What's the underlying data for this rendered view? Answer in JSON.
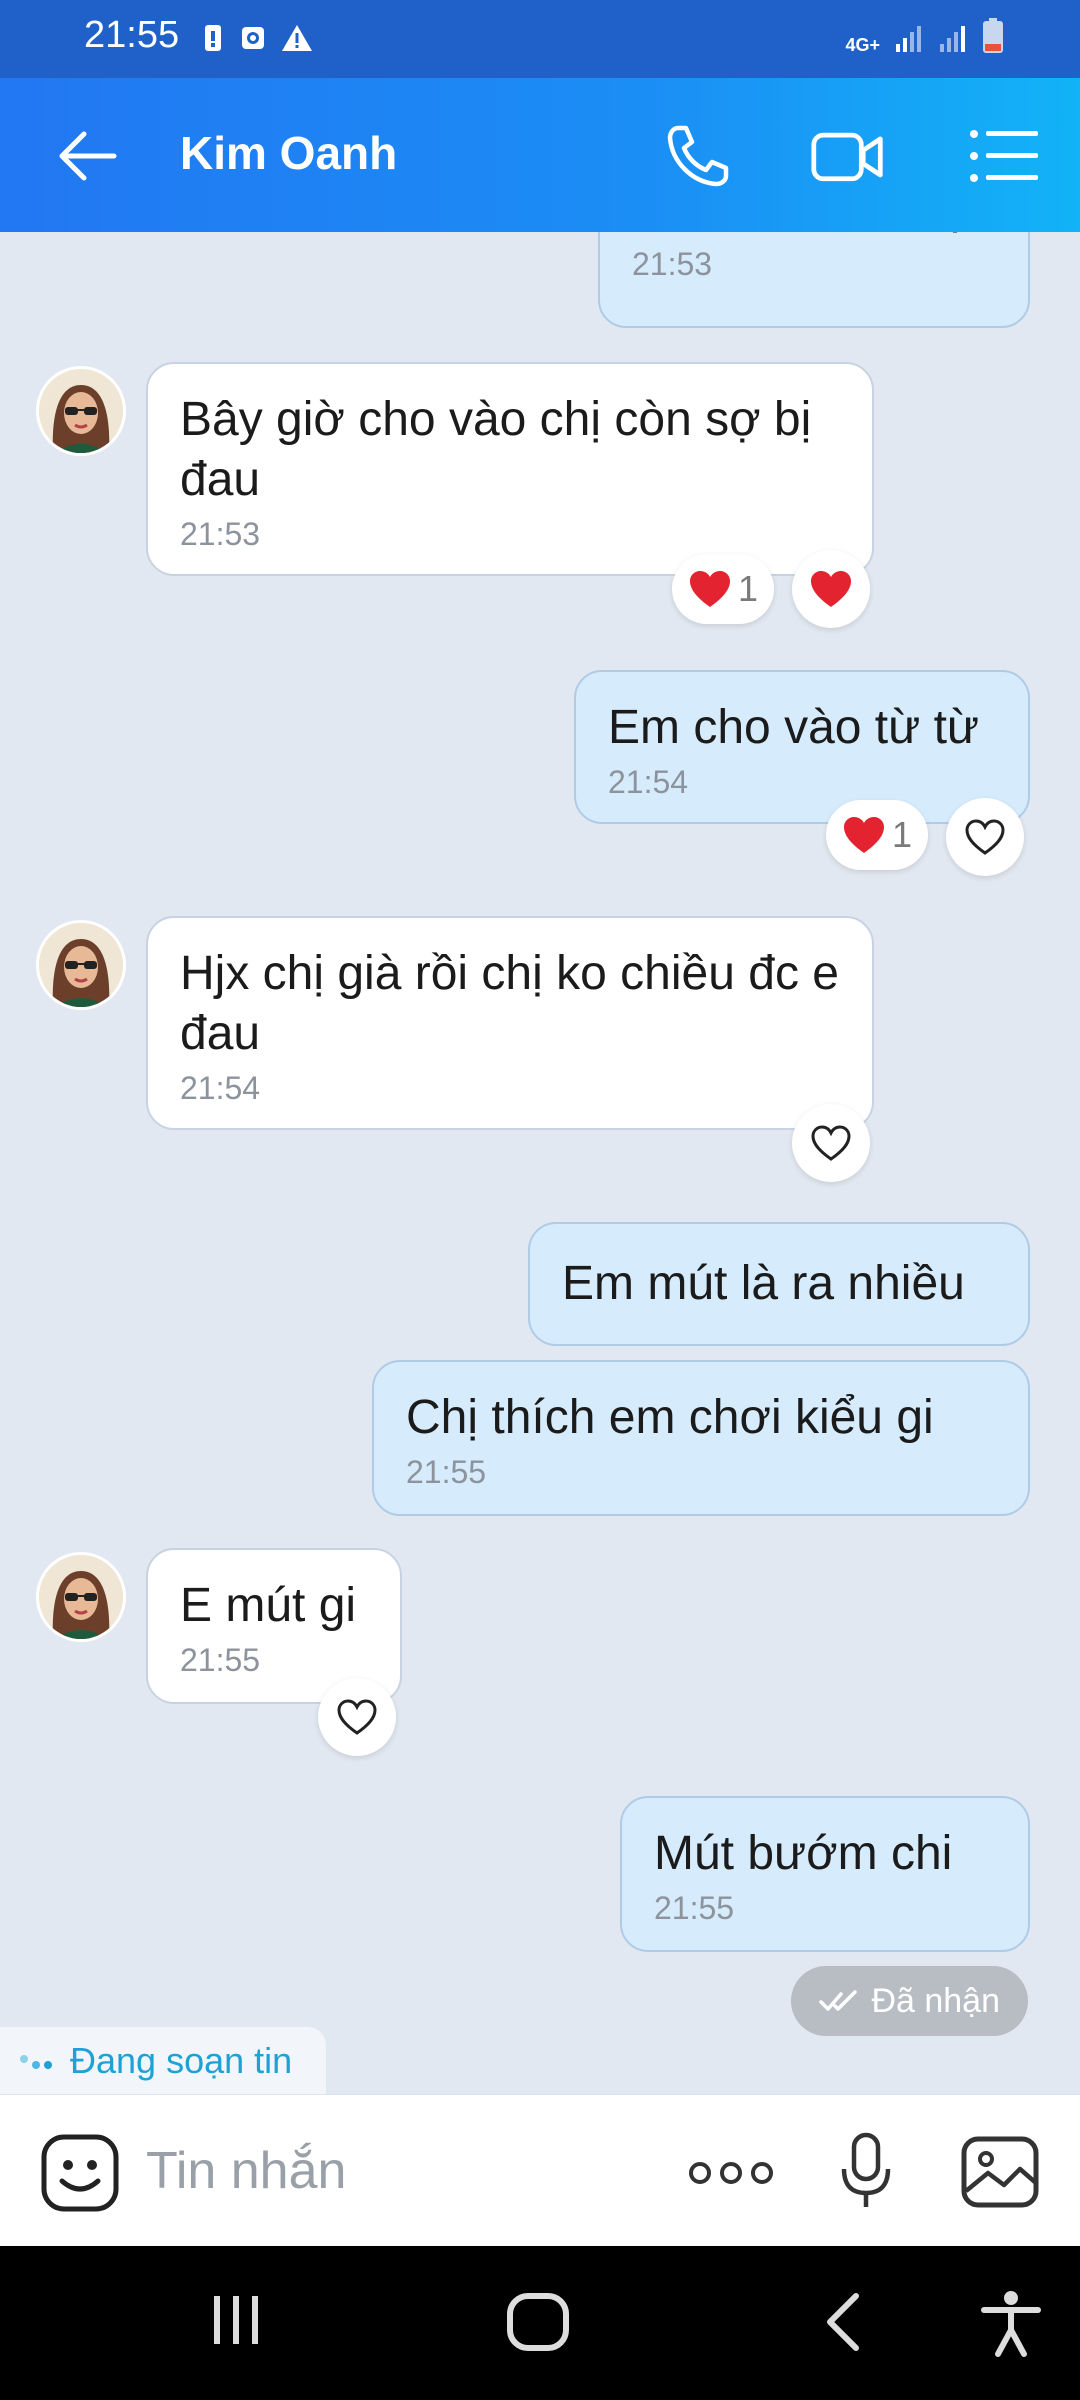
{
  "status_bar": {
    "time": "21:55",
    "network": "4G+"
  },
  "header": {
    "contact_name": "Kim Oanh"
  },
  "messages": [
    {
      "direction": "out",
      "text": "Em đút  vào nhẹ",
      "time": "21:53"
    },
    {
      "direction": "in",
      "text": "Bây giờ cho vào chị còn sợ bị đau",
      "time": "21:53",
      "reaction_count": "1"
    },
    {
      "direction": "out",
      "text": "Em cho vào từ từ",
      "time": "21:54",
      "reaction_count": "1"
    },
    {
      "direction": "in",
      "text": "Hjx chị già rồi chị ko chiều đc e đau",
      "time": "21:54"
    },
    {
      "direction": "out",
      "text": "Em mút là ra nhiều",
      "time": ""
    },
    {
      "direction": "out",
      "text": "Chị thích em chơi  kiểu  gi",
      "time": "21:55"
    },
    {
      "direction": "in",
      "text": "E mút gi",
      "time": "21:55"
    },
    {
      "direction": "out",
      "text": "Mút  bướm  chi",
      "time": "21:55"
    }
  ],
  "delivery_status": "Đã nhận",
  "typing_indicator": "Đang soạn tin",
  "composer": {
    "placeholder": "Tin nhắn"
  },
  "colors": {
    "header_start": "#2277f2",
    "header_end": "#12b3f7",
    "outgoing_bubble": "#d6ecfd",
    "incoming_bubble": "#ffffff",
    "heart": "#e3232f"
  }
}
